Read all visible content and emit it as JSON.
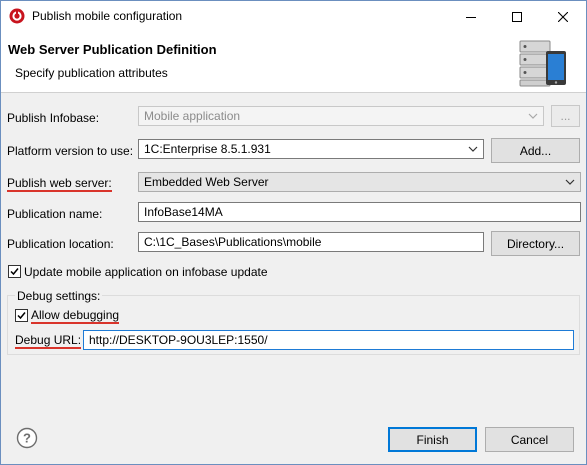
{
  "window": {
    "title": "Publish mobile configuration"
  },
  "banner": {
    "title": "Web Server Publication Definition",
    "subtitle": "Specify publication attributes",
    "icon": "server-mobile-icon"
  },
  "form": {
    "infobase_label": "Publish Infobase:",
    "infobase_value": "Mobile application",
    "infobase_button": "...",
    "platform_label": "Platform version to use:",
    "platform_value": "1C:Enterprise 8.5.1.931",
    "platform_button": "Add...",
    "server_label": "Publish web server:",
    "server_value": "Embedded Web Server",
    "name_label": "Publication name:",
    "name_value": "InfoBase14MA",
    "location_label": "Publication location:",
    "location_value": "C:\\1C_Bases\\Publications\\mobile",
    "location_button": "Directory...",
    "update_label": "Update mobile application on infobase update",
    "update_checked": true
  },
  "debug": {
    "group_label": "Debug settings:",
    "allow_label": "Allow debugging",
    "allow_checked": true,
    "url_label": "Debug URL:",
    "url_value": "http://DESKTOP-9OU3LEP:1550/"
  },
  "footer": {
    "finish": "Finish",
    "cancel": "Cancel"
  },
  "colors": {
    "accent": "#0078d7",
    "underline": "#d9342b"
  }
}
